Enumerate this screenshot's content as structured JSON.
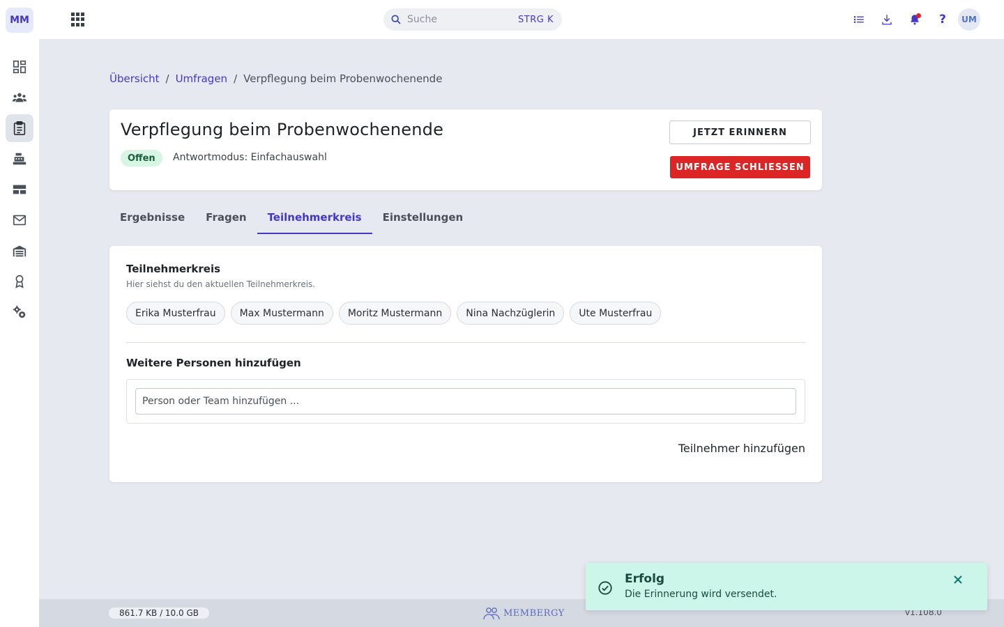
{
  "app": {
    "logo_text": "MM",
    "accent_color": "#4338ca",
    "danger_color": "#dc2626"
  },
  "sidebar": {
    "items": [
      {
        "icon": "dashboard-icon",
        "active": false
      },
      {
        "icon": "members-icon",
        "active": false
      },
      {
        "icon": "clipboard-icon",
        "active": true
      },
      {
        "icon": "cash-register-icon",
        "active": false
      },
      {
        "icon": "table-icon",
        "active": false
      },
      {
        "icon": "mail-icon",
        "active": false
      },
      {
        "icon": "warehouse-icon",
        "active": false
      },
      {
        "icon": "award-icon",
        "active": false
      },
      {
        "icon": "settings-icon",
        "active": false
      }
    ]
  },
  "topbar": {
    "search_placeholder": "Suche",
    "search_shortcut": "STRG K",
    "help_label": "?",
    "avatar_initials": "UM",
    "icons": [
      "apps-grid-icon",
      "search-icon",
      "list-icon",
      "download-icon",
      "bell-icon",
      "help-icon"
    ]
  },
  "breadcrumb": {
    "items": [
      "Übersicht",
      "Umfragen",
      "Verpflegung beim Probenwochenende"
    ],
    "separator": "/"
  },
  "survey": {
    "title": "Verpflegung beim Probenwochenende",
    "status": "Offen",
    "mode": "Antwortmodus: Einfachauswahl",
    "remind_button": "JETZT ERINNERN",
    "close_button": "UMFRAGE SCHLIESSEN"
  },
  "tabs": [
    {
      "label": "Ergebnisse",
      "active": false
    },
    {
      "label": "Fragen",
      "active": false
    },
    {
      "label": "Teilnehmerkreis",
      "active": true
    },
    {
      "label": "Einstellungen",
      "active": false
    }
  ],
  "participants": {
    "title": "Teilnehmerkreis",
    "subtitle": "Hier siehst du den aktuellen Teilnehmerkreis.",
    "people": [
      "Erika Musterfrau",
      "Max Mustermann",
      "Moritz Mustermann",
      "Nina Nachzüglerin",
      "Ute Musterfrau"
    ],
    "add_title": "Weitere Personen hinzufügen",
    "add_placeholder": "Person oder Team hinzufügen ...",
    "add_button": "Teilnehmer hinzufügen"
  },
  "footer": {
    "storage": "861.7 KB / 10.0 GB",
    "brand": "MEMBERGY",
    "version": "v1.108.0"
  },
  "toast": {
    "title": "Erfolg",
    "message": "Die Erinnerung wird versendet."
  }
}
